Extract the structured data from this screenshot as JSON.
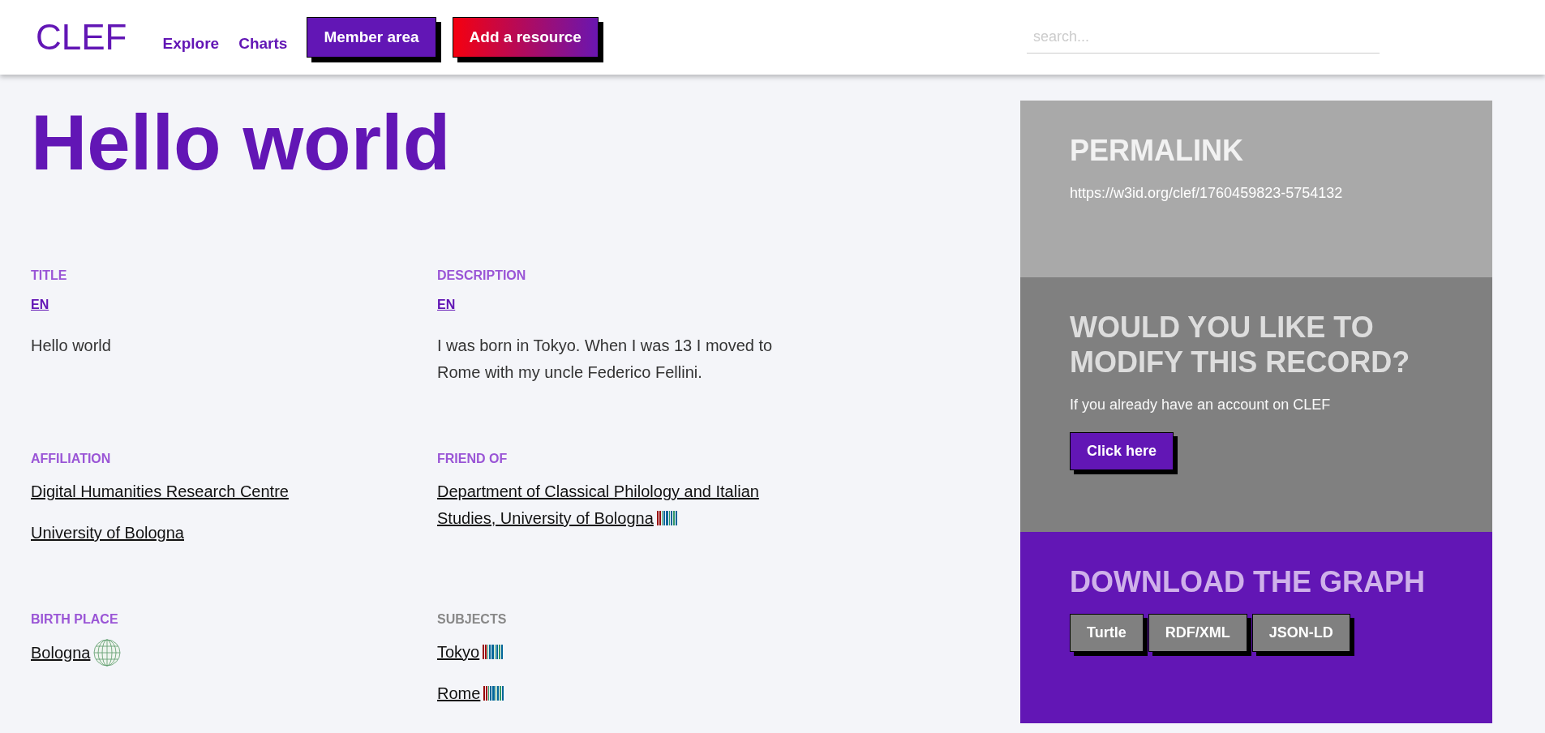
{
  "brand": "CLEF",
  "nav": [
    {
      "label": "Explore",
      "kind": "link"
    },
    {
      "label": "Charts",
      "kind": "link"
    },
    {
      "label": "Member area",
      "kind": "primary"
    },
    {
      "label": "Add a resource",
      "kind": "gradient"
    }
  ],
  "search": {
    "placeholder": "search..."
  },
  "heading": "Hello world",
  "fields": [
    {
      "label": "TITLE",
      "dimmed": false,
      "lang": "EN",
      "values": [
        {
          "kind": "text",
          "text": "Hello world"
        }
      ]
    },
    {
      "label": "DESCRIPTION",
      "dimmed": false,
      "lang": "EN",
      "values": [
        {
          "kind": "text",
          "text": "I was born in Tokyo. When I was 13 I moved to Rome with my uncle Federico Fellini."
        }
      ]
    },
    {
      "label": "AFFILIATION",
      "dimmed": false,
      "values": [
        {
          "kind": "link",
          "text": "Digital Humanities Research Centre"
        },
        {
          "kind": "link",
          "text": "University of Bologna"
        }
      ]
    },
    {
      "label": "FRIEND OF",
      "dimmed": false,
      "values": [
        {
          "kind": "barcode-link",
          "text": "Department of Classical Philology and Italian Studies, University of Bologna"
        }
      ]
    },
    {
      "label": "BIRTH PLACE",
      "dimmed": false,
      "values": [
        {
          "kind": "globe-link",
          "text": "Bologna"
        }
      ]
    },
    {
      "label": "SUBJECTS",
      "dimmed": true,
      "values": [
        {
          "kind": "barcode-link",
          "text": "Tokyo"
        },
        {
          "kind": "barcode-link",
          "text": "Rome"
        }
      ]
    }
  ],
  "sidebar": [
    {
      "kind": "permalink",
      "title": "PERMALINK",
      "text": "https://w3id.org/clef/1760459823-5754132"
    },
    {
      "kind": "modify",
      "title": "WOULD YOU LIKE TO MODIFY THIS RECORD?",
      "text": "If you already have an account on CLEF",
      "buttons": [
        "Click here"
      ]
    },
    {
      "kind": "download",
      "title": "DOWNLOAD THE GRAPH",
      "buttons": [
        "Turtle",
        "RDF/XML",
        "JSON-LD"
      ]
    }
  ]
}
